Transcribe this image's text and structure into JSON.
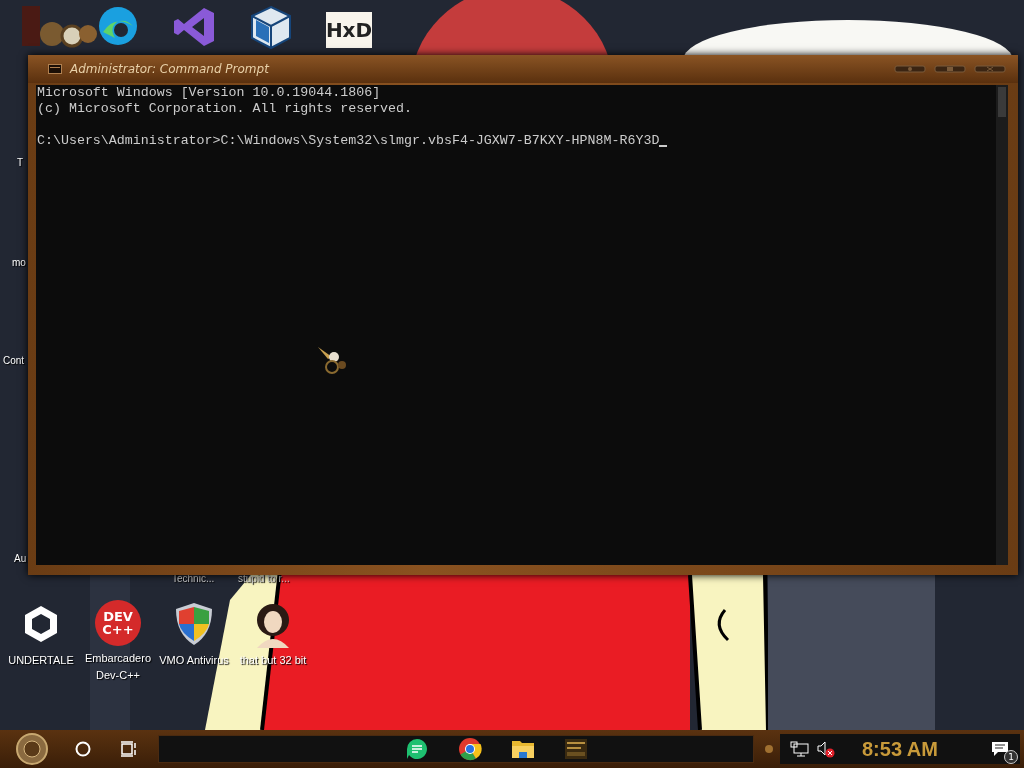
{
  "desktop": {
    "top_icons": [
      {
        "kind": "gears"
      },
      {
        "kind": "edge"
      },
      {
        "kind": "visualstudio"
      },
      {
        "kind": "virtualbox"
      },
      {
        "kind": "hxd",
        "logo_text": "HxD"
      }
    ],
    "left_labels": [
      "T",
      "mo",
      "Cont",
      "Au"
    ],
    "cut_labels": [
      "Technic...",
      "stupid to r..."
    ],
    "bottom_icons": [
      {
        "kind": "unity",
        "label": "UNDERTALE"
      },
      {
        "kind": "devcpp",
        "label": "Embarcadero Dev-C++",
        "logo_lines": [
          "DEV",
          "C++"
        ]
      },
      {
        "kind": "shield",
        "label": "VMO Antivirus"
      },
      {
        "kind": "portrait",
        "label": "that but 32 bit"
      }
    ]
  },
  "window": {
    "title": "Administrator: Command Prompt",
    "console": {
      "lines": [
        "Microsoft Windows [Version 10.0.19044.1806]",
        "(c) Microsoft Corporation. All rights reserved."
      ],
      "prompt": "C:\\Users\\Administrator>C:\\Windows\\System32\\slmgr.vbsF4-JGXW7-B7KXY-HPN8M-R6Y3D"
    }
  },
  "taskbar": {
    "apps": [
      {
        "kind": "chat"
      },
      {
        "kind": "chrome"
      },
      {
        "kind": "folder"
      },
      {
        "kind": "thumbnail"
      }
    ],
    "volume_muted": true,
    "clock": "8:53 AM",
    "notification_count": "1"
  }
}
